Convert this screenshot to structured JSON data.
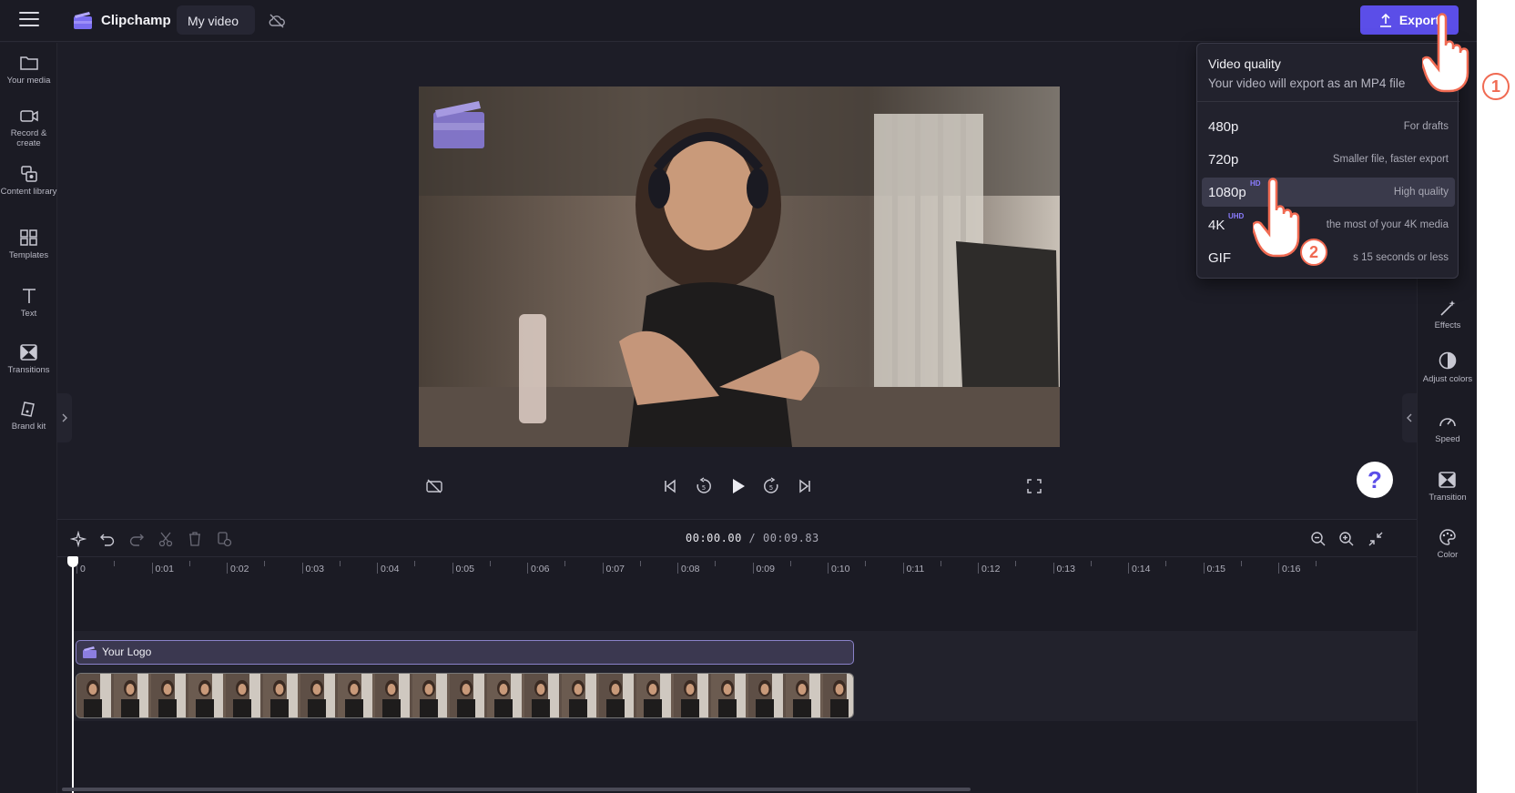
{
  "topbar": {
    "brand": "Clipchamp",
    "project_title": "My video",
    "export_label": "Export"
  },
  "left_sidebar": {
    "items": [
      {
        "label": "Your media",
        "icon": "folder-icon"
      },
      {
        "label": "Record & create",
        "icon": "camera-icon"
      },
      {
        "label": "Content library",
        "icon": "content-library-icon"
      },
      {
        "label": "Templates",
        "icon": "templates-icon"
      },
      {
        "label": "Text",
        "icon": "text-icon"
      },
      {
        "label": "Transitions",
        "icon": "transitions-icon"
      },
      {
        "label": "Brand kit",
        "icon": "brand-kit-icon"
      }
    ]
  },
  "right_sidebar": {
    "items": [
      {
        "label": "Effects",
        "icon": "magic-wand-icon"
      },
      {
        "label": "Adjust colors",
        "icon": "contrast-icon"
      },
      {
        "label": "Speed",
        "icon": "speedometer-icon"
      },
      {
        "label": "Transition",
        "icon": "transition-icon"
      },
      {
        "label": "Color",
        "icon": "palette-icon"
      }
    ]
  },
  "export_dropdown": {
    "title": "Video quality",
    "subtitle": "Your video will export as an MP4 file",
    "options": [
      {
        "resolution": "480p",
        "badge": "",
        "description": "For drafts",
        "selected": false
      },
      {
        "resolution": "720p",
        "badge": "",
        "description": "Smaller file, faster export",
        "selected": false
      },
      {
        "resolution": "1080p",
        "badge": "HD",
        "description": "High quality",
        "selected": true
      },
      {
        "resolution": "4K",
        "badge": "UHD",
        "description": "the most of your 4K media",
        "selected": false
      },
      {
        "resolution": "GIF",
        "badge": "",
        "description": "s 15 seconds or less",
        "selected": false
      }
    ]
  },
  "timeline": {
    "current_time": "00:00.00",
    "total_time": "/ 00:09.83",
    "ruler_labels": [
      "0",
      "0:01",
      "0:02",
      "0:03",
      "0:04",
      "0:05",
      "0:06",
      "0:07",
      "0:08",
      "0:09",
      "0:10",
      "0:11",
      "0:12",
      "0:13",
      "0:14",
      "0:15",
      "0:16"
    ],
    "logo_clip_label": "Your Logo"
  },
  "help": {
    "label": "?"
  },
  "annotations": {
    "step1": "1",
    "step2": "2"
  },
  "colors": {
    "accent": "#5b4ee8",
    "background": "#1d1d27",
    "step_marker": "#f06a52"
  }
}
